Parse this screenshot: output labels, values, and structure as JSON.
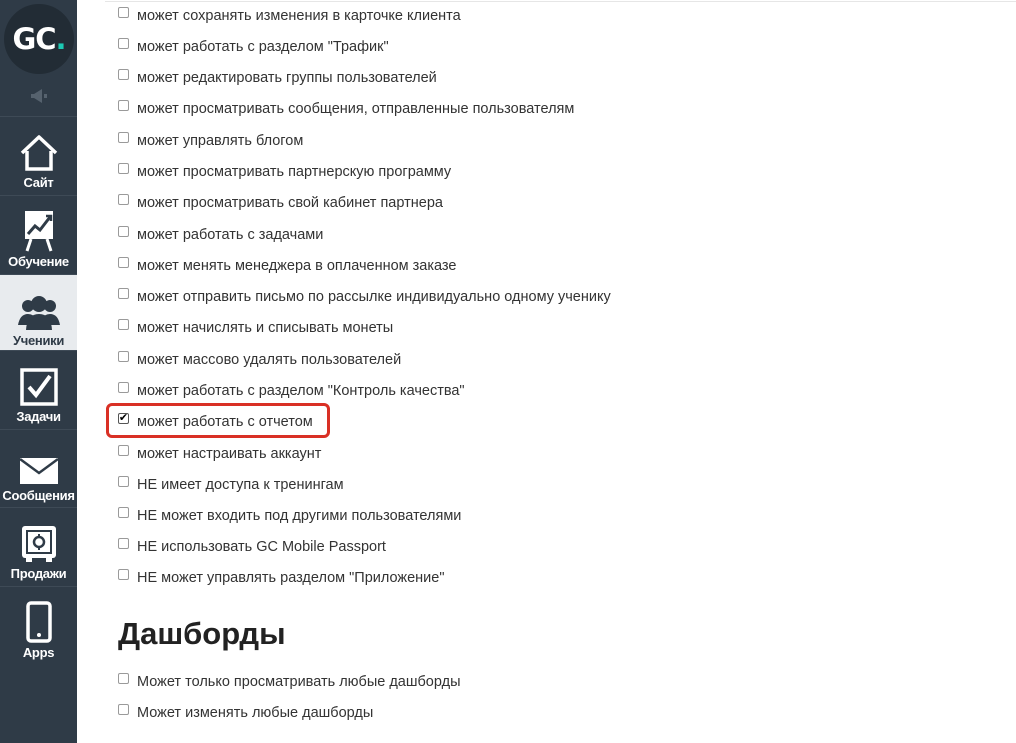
{
  "logo": {
    "text": "GC",
    "dot": "."
  },
  "sidebar": {
    "items": [
      {
        "label": "Сайт",
        "icon": "home-icon",
        "active": false
      },
      {
        "label": "Обучение",
        "icon": "chart-easel-icon",
        "active": false
      },
      {
        "label": "Ученики",
        "icon": "users-icon",
        "active": true
      },
      {
        "label": "Задачи",
        "icon": "checkbox-icon",
        "active": false
      },
      {
        "label": "Сообщения",
        "icon": "envelope-icon",
        "active": false
      },
      {
        "label": "Продажи",
        "icon": "safe-icon",
        "active": false
      },
      {
        "label": "Apps",
        "icon": "phone-icon",
        "active": false
      }
    ]
  },
  "permissions": [
    {
      "label": "может сохранять изменения в карточке клиента",
      "checked": false
    },
    {
      "label": "может работать с разделом \"Трафик\"",
      "checked": false
    },
    {
      "label": "может редактировать группы пользователей",
      "checked": false
    },
    {
      "label": "может просматривать сообщения, отправленные пользователям",
      "checked": false
    },
    {
      "label": "может управлять блогом",
      "checked": false
    },
    {
      "label": "может просматривать партнерскую программу",
      "checked": false
    },
    {
      "label": "может просматривать свой кабинет партнера",
      "checked": false
    },
    {
      "label": "может работать с задачами",
      "checked": false
    },
    {
      "label": "может менять менеджера в оплаченном заказе",
      "checked": false
    },
    {
      "label": "может отправить письмо по рассылке индивидуально одному ученику",
      "checked": false
    },
    {
      "label": "может начислять и списывать монеты",
      "checked": false
    },
    {
      "label": "может массово удалять пользователей",
      "checked": false
    },
    {
      "label": "может работать с разделом \"Контроль качества\"",
      "checked": false
    },
    {
      "label": "может работать с отчетом",
      "checked": true
    },
    {
      "label": "может настраивать аккаунт",
      "checked": false
    },
    {
      "label": "НЕ имеет доступа к тренингам",
      "checked": false
    },
    {
      "label": "НЕ может входить под другими пользователями",
      "checked": false
    },
    {
      "label": "НЕ использовать GC Mobile Passport",
      "checked": false
    },
    {
      "label": "НЕ может управлять разделом \"Приложение\"",
      "checked": false
    }
  ],
  "dashboards": {
    "title": "Дашборды",
    "items": [
      {
        "label": "Может только просматривать любые дашборды",
        "checked": false
      },
      {
        "label": "Может изменять любые дашборды",
        "checked": false
      }
    ]
  },
  "colors": {
    "sidebar": "#2f3b47",
    "accent": "#1cc9b3",
    "highlight": "#d93025"
  }
}
